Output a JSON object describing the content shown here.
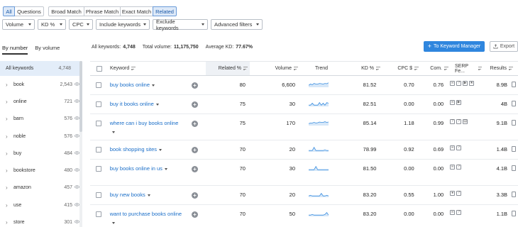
{
  "match_tabs": [
    "All",
    "Questions",
    "Broad Match",
    "Phrase Match",
    "Exact Match",
    "Related"
  ],
  "active_match_tabs": [
    "All",
    "Related"
  ],
  "filters": [
    {
      "label": "Volume",
      "caret": true
    },
    {
      "label": "KD %",
      "caret": true
    },
    {
      "label": "CPC",
      "caret": true
    },
    {
      "label": "Include keywords",
      "caret": true
    },
    {
      "label": "Exclude keywords",
      "caret": true
    },
    {
      "label": "Advanced filters",
      "caret": true
    }
  ],
  "view_toggle": {
    "by_number": "By number",
    "by_volume": "By volume"
  },
  "stats": {
    "all_keywords_label": "All keywords:",
    "all_keywords_value": "4,748",
    "total_volume_label": "Total volume:",
    "total_volume_value": "11,175,750",
    "avg_kd_label": "Average KD:",
    "avg_kd_value": "77.67%"
  },
  "buttons": {
    "keyword_manager": "To Keyword Manager",
    "export": "Export"
  },
  "sidebar": {
    "all": {
      "label": "All keywords",
      "count": "4,748"
    },
    "items": [
      {
        "label": "book",
        "count": "2,543"
      },
      {
        "label": "online",
        "count": "721"
      },
      {
        "label": "barn",
        "count": "576"
      },
      {
        "label": "noble",
        "count": "576"
      },
      {
        "label": "buy",
        "count": "484"
      },
      {
        "label": "bookstore",
        "count": "480"
      },
      {
        "label": "amazon",
        "count": "457"
      },
      {
        "label": "use",
        "count": "415"
      },
      {
        "label": "store",
        "count": "301"
      }
    ]
  },
  "table": {
    "headers": {
      "keyword": "Keyword",
      "related": "Related %",
      "volume": "Volume",
      "trend": "Trend",
      "kd": "KD %",
      "cpc": "CPC $",
      "com": "Com.",
      "serp": "SERP Fe...",
      "results": "Results"
    },
    "rows": [
      {
        "keyword": "buy books online",
        "related": "80",
        "volume": "6,600",
        "kd": "81.52",
        "cpc": "0.70",
        "com": "0.76",
        "serp": [
          "link-icon",
          "faq-icon",
          "video-icon",
          "reviews-icon"
        ],
        "results": "8.9B",
        "trend": [
          0.3,
          0.5,
          0.4,
          0.6,
          0.5,
          0.5,
          0.6,
          0.55,
          0.5,
          0.6,
          0.55,
          0.7
        ]
      },
      {
        "keyword": "buy it books online",
        "related": "75",
        "volume": "30",
        "kd": "82.51",
        "cpc": "0.00",
        "com": "0.00",
        "serp": [
          "link-icon",
          "video-icon"
        ],
        "results": "4B",
        "trend": [
          0.2,
          0.2,
          0.5,
          0.2,
          0.2,
          0.2,
          0.6,
          0.2,
          0.5,
          0.2,
          0.6,
          0.5
        ]
      },
      {
        "keyword": "where can i buy books online",
        "related": "75",
        "volume": "170",
        "kd": "85.14",
        "cpc": "1.18",
        "com": "0.99",
        "serp": [
          "faq-icon",
          "faq-icon",
          "shopping-icon"
        ],
        "results": "9.1B",
        "trend": [
          0.3,
          0.4,
          0.4,
          0.5,
          0.4,
          0.45,
          0.55,
          0.5,
          0.5,
          0.6,
          0.5,
          0.55
        ]
      },
      {
        "keyword": "book shopping sites",
        "related": "70",
        "volume": "20",
        "kd": "78.99",
        "cpc": "0.92",
        "com": "0.69",
        "serp": [
          "link-icon",
          "faq-icon"
        ],
        "results": "1.4B",
        "trend": [
          0.2,
          0.2,
          0.2,
          0.7,
          0.2,
          0.2,
          0.2,
          0.2,
          0.2,
          0.3,
          0.2,
          0.2
        ]
      },
      {
        "keyword": "buy books online in us",
        "related": "70",
        "volume": "30",
        "kd": "81.50",
        "cpc": "0.00",
        "com": "0.00",
        "serp": [
          "link-icon",
          "faq-icon"
        ],
        "results": "4.1B",
        "trend": [
          0.2,
          0.2,
          0.2,
          0.2,
          0.7,
          0.2,
          0.2,
          0.2,
          0.2,
          0.2,
          0.2,
          0.2
        ]
      },
      {
        "keyword": "buy new books",
        "related": "70",
        "volume": "20",
        "kd": "83.20",
        "cpc": "0.55",
        "com": "1.00",
        "serp": [
          "pin-icon",
          "faq-icon"
        ],
        "results": "3.3B",
        "trend": [
          0.2,
          0.3,
          0.2,
          0.2,
          0.2,
          0.2,
          0.2,
          0.6,
          0.2,
          0.2,
          0.3,
          0.2
        ]
      },
      {
        "keyword": "want to purchase books online",
        "related": "70",
        "volume": "50",
        "kd": "83.20",
        "cpc": "0.00",
        "com": "0.00",
        "serp": [
          "link-icon",
          "faq-icon"
        ],
        "results": "1.1B",
        "trend": [
          0.2,
          0.2,
          0.3,
          0.2,
          0.2,
          0.2,
          0.2,
          0.2,
          0.2,
          0.3,
          0.6,
          0.2
        ]
      }
    ]
  },
  "colors": {
    "accent": "#2f86de",
    "link": "#1a6ec8",
    "active_tab_bg": "#dde9f8"
  }
}
